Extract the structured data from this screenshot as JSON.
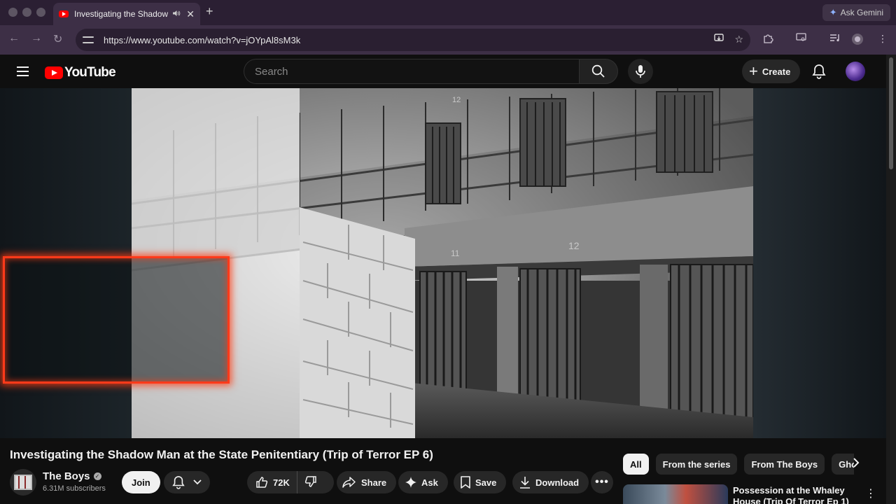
{
  "browser": {
    "tab_title": "Investigating the Shadow",
    "tab_audio_icon": "speaker-icon",
    "url": "https://www.youtube.com/watch?v=jOYpAl8sM3k",
    "ask_gemini_label": "Ask Gemini"
  },
  "masthead": {
    "logo_text": "YouTube",
    "search_placeholder": "Search",
    "create_label": "Create"
  },
  "video": {
    "title": "Investigating the Shadow Man at the State Penitentiary (Trip of Terror EP 6)",
    "channel_name": "The Boys",
    "subscribers": "6.31M subscribers",
    "join_label": "Join",
    "likes": "72K",
    "share_label": "Share",
    "ask_label": "Ask",
    "save_label": "Save",
    "download_label": "Download",
    "cell_numbers": [
      "12",
      "11",
      "12"
    ]
  },
  "sidebar": {
    "chips": [
      {
        "label": "All",
        "active": true
      },
      {
        "label": "From the series",
        "active": false
      },
      {
        "label": "From The Boys",
        "active": false
      },
      {
        "label": "Ghos",
        "active": false
      }
    ],
    "recommendation_title": "Possession at the Whaley House (Trip Of Terror Ep 1)"
  },
  "colors": {
    "youtube_red": "#ff0000",
    "highlight_box": "#ff3a1a",
    "page_bg": "#0f0f0f",
    "browser_frame": "#3d2f46"
  }
}
